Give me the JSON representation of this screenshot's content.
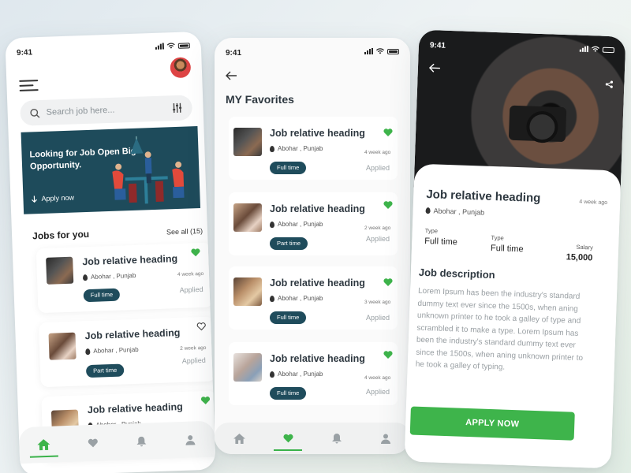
{
  "colors": {
    "accent_green": "#3eb44b",
    "dark_teal": "#1f4c5c",
    "muted": "#9aa1a5"
  },
  "status": {
    "time": "9:41"
  },
  "home": {
    "search_placeholder": "Search job here...",
    "banner": {
      "title": "Looking for Job Open Big Opportunity.",
      "link": "Apply now"
    },
    "section_title": "Jobs for you",
    "see_all": "See all (15)",
    "jobs": [
      {
        "title": "Job relative heading",
        "location": "Abohar , Punjab",
        "ago": "4 week ago",
        "type": "Full time",
        "status": "Applied",
        "favorite": true
      },
      {
        "title": "Job relative heading",
        "location": "Abohar , Punjab",
        "ago": "2 week ago",
        "type": "Part time",
        "status": "Applied",
        "favorite": false
      },
      {
        "title": "Job relative heading",
        "location": "Abohar , Punjab",
        "ago": "",
        "type": "",
        "status": "",
        "favorite": true
      }
    ],
    "nav": [
      "home-icon",
      "heart-icon",
      "bell-icon",
      "profile-icon"
    ]
  },
  "favorites": {
    "title": "MY Favorites",
    "items": [
      {
        "title": "Job relative heading",
        "location": "Abohar , Punjab",
        "ago": "4 week ago",
        "type": "Full time",
        "status": "Applied"
      },
      {
        "title": "Job relative heading",
        "location": "Abohar , Punjab",
        "ago": "2 week ago",
        "type": "Part time",
        "status": "Applied"
      },
      {
        "title": "Job relative heading",
        "location": "Abohar , Punjab",
        "ago": "3 week ago",
        "type": "Full time",
        "status": "Applied"
      },
      {
        "title": "Job relative heading",
        "location": "Abohar , Punjab",
        "ago": "4 week ago",
        "type": "Full time",
        "status": "Applied"
      }
    ]
  },
  "detail": {
    "title": "Job relative heading",
    "ago": "4 week ago",
    "location": "Abohar , Punjab",
    "type1_label": "Type",
    "type1_value": "Full time",
    "type2_label": "Type",
    "type2_value": "Full time",
    "salary_label": "Salary",
    "salary_value": "15,000",
    "desc_heading": "Job description",
    "description": "Lorem Ipsum has been the industry's standard dummy text ever since the 1500s, when aning unknown printer to he took a galley of type and scrambled it to make a type. Lorem Ipsum has been the industry's standard dummy text ever since the 1500s, when aning unknown printer to he took a galley of typing.",
    "apply_label": "APPLY NOW"
  }
}
